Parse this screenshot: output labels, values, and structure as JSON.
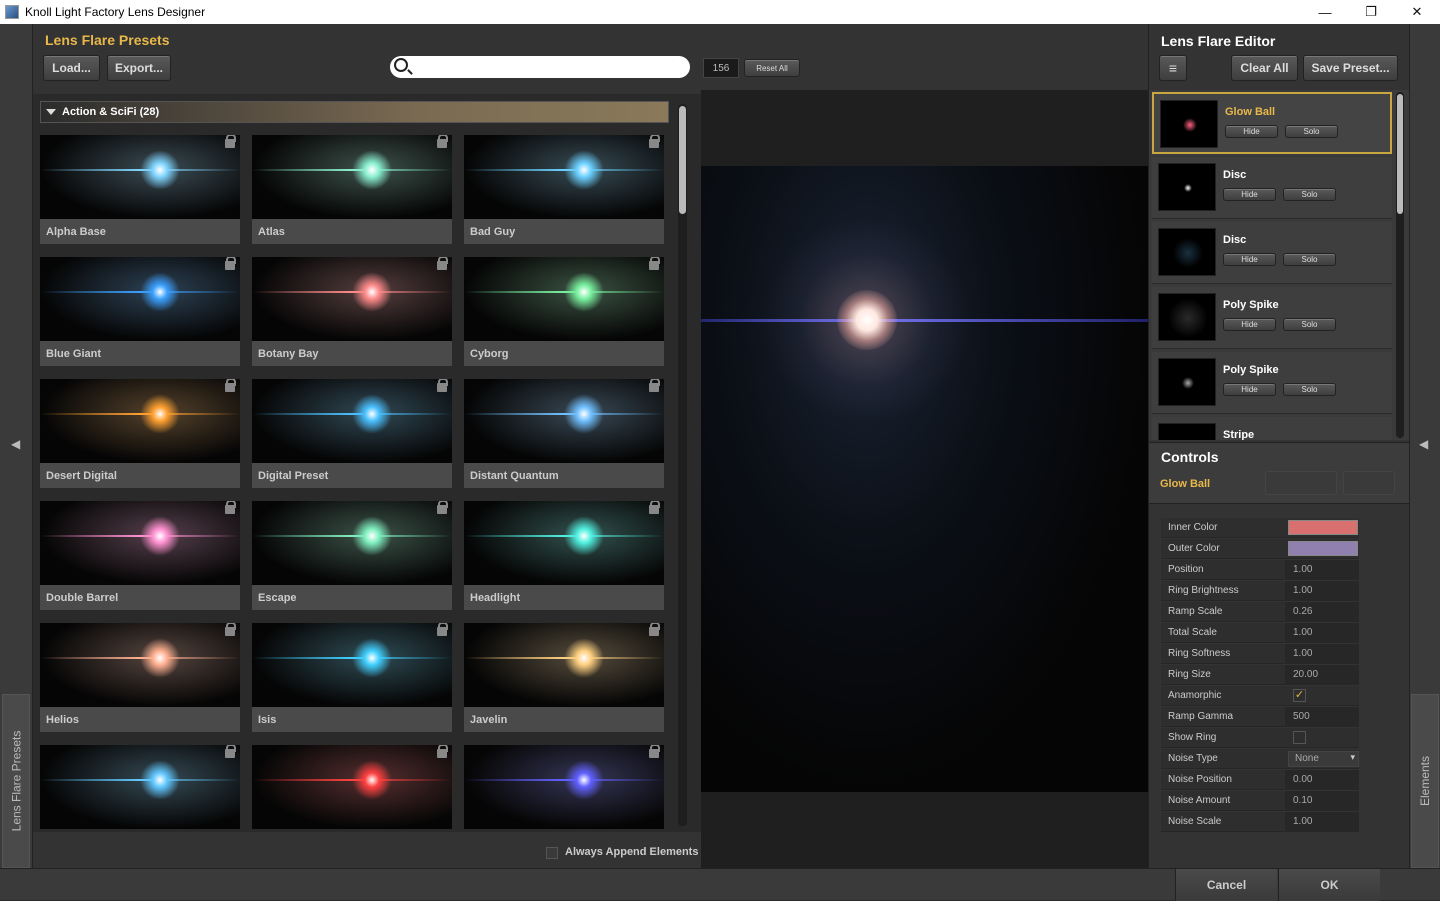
{
  "window": {
    "title": "Knoll Light Factory Lens Designer",
    "minimize": "—",
    "maximize": "❐",
    "close": "✕"
  },
  "presets": {
    "title": "Lens Flare Presets",
    "load_label": "Load...",
    "export_label": "Export...",
    "search_value": "",
    "category": "Action & SciFi (28)",
    "always_append": "Always Append Elements",
    "tiles": [
      {
        "label": "Alpha Base",
        "color": "#7fd4ff"
      },
      {
        "label": "Atlas",
        "color": "#8af0d0"
      },
      {
        "label": "Bad Guy",
        "color": "#6ad0ff"
      },
      {
        "label": "Blue Giant",
        "color": "#3aa0ff"
      },
      {
        "label": "Botany Bay",
        "color": "#ff8a8a"
      },
      {
        "label": "Cyborg",
        "color": "#7af0a0"
      },
      {
        "label": "Desert Digital",
        "color": "#ffa030"
      },
      {
        "label": "Digital Preset",
        "color": "#4ac0ff"
      },
      {
        "label": "Distant Quantum",
        "color": "#70c0ff"
      },
      {
        "label": "Double Barrel",
        "color": "#ff90d0"
      },
      {
        "label": "Escape",
        "color": "#80f0c0"
      },
      {
        "label": "Headlight",
        "color": "#50f0e0"
      },
      {
        "label": "Helios",
        "color": "#ffb090"
      },
      {
        "label": "Isis",
        "color": "#40d0ff"
      },
      {
        "label": "Javelin",
        "color": "#ffd080"
      },
      {
        "label": "",
        "color": "#60c8ff"
      },
      {
        "label": "",
        "color": "#ff4040"
      },
      {
        "label": "",
        "color": "#6060ff"
      }
    ]
  },
  "viewport": {
    "number": "156",
    "reset_all": "Reset All"
  },
  "editor": {
    "title": "Lens Flare Editor",
    "menu_icon": "≡",
    "clear_all": "Clear All",
    "save_preset": "Save Preset...",
    "hide_label": "Hide",
    "solo_label": "Solo",
    "elements": [
      {
        "name": "Glow Ball"
      },
      {
        "name": "Disc"
      },
      {
        "name": "Disc"
      },
      {
        "name": "Poly Spike"
      },
      {
        "name": "Poly Spike"
      },
      {
        "name": "Stripe"
      }
    ]
  },
  "controls": {
    "title": "Controls",
    "selected": "Glow Ball",
    "props": [
      {
        "label": "Inner Color",
        "type": "color",
        "value": "#d87070"
      },
      {
        "label": "Outer Color",
        "type": "color",
        "value": "#9080b0"
      },
      {
        "label": "Position",
        "type": "num",
        "value": "1.00"
      },
      {
        "label": "Ring Brightness",
        "type": "num",
        "value": "1.00"
      },
      {
        "label": "Ramp Scale",
        "type": "num",
        "value": "0.26"
      },
      {
        "label": "Total Scale",
        "type": "num",
        "value": "1.00"
      },
      {
        "label": "Ring Softness",
        "type": "num",
        "value": "1.00"
      },
      {
        "label": "Ring Size",
        "type": "num",
        "value": "20.00"
      },
      {
        "label": "Anamorphic",
        "type": "check",
        "value": true
      },
      {
        "label": "Ramp Gamma",
        "type": "num",
        "value": "500"
      },
      {
        "label": "Show Ring",
        "type": "check",
        "value": false
      },
      {
        "label": "Noise Type",
        "type": "select",
        "value": "None"
      },
      {
        "label": "Noise Position",
        "type": "num",
        "value": "0.00"
      },
      {
        "label": "Noise Amount",
        "type": "num",
        "value": "0.10"
      },
      {
        "label": "Noise Scale",
        "type": "num",
        "value": "1.00"
      }
    ]
  },
  "side": {
    "left_tab": "Lens Flare Presets",
    "right_tab": "Elements",
    "left_arrow": "◀",
    "right_arrow": "◀"
  },
  "footer": {
    "cancel": "Cancel",
    "ok": "OK"
  }
}
